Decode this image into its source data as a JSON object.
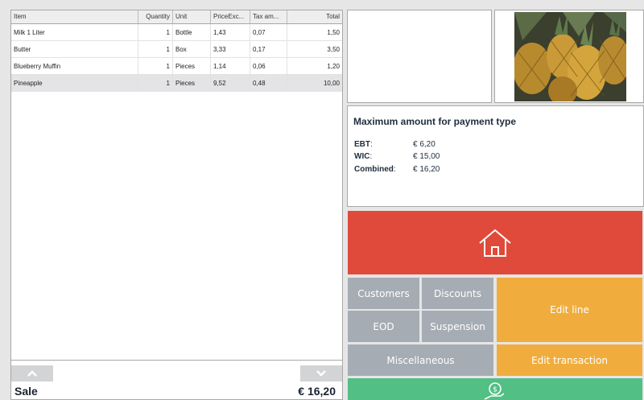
{
  "grid": {
    "columns": [
      "Item",
      "Quantity",
      "Unit",
      "PriceExc...",
      "Tax am...",
      "Total"
    ],
    "rows": [
      {
        "item": "Milk 1 Liter",
        "quantity": "1",
        "unit": "Bottle",
        "price": "1,43",
        "tax": "0,07",
        "total": "1,50"
      },
      {
        "item": "Butter",
        "quantity": "1",
        "unit": "Box",
        "price": "3,33",
        "tax": "0,17",
        "total": "3,50"
      },
      {
        "item": "Blueberry Muffin",
        "quantity": "1",
        "unit": "Pieces",
        "price": "1,14",
        "tax": "0,06",
        "total": "1,20"
      },
      {
        "item": "Pineapple",
        "quantity": "1",
        "unit": "Pieces",
        "price": "9,52",
        "tax": "0,48",
        "total": "10,00"
      }
    ]
  },
  "sale": {
    "label": "Sale",
    "total": "€ 16,20"
  },
  "payment": {
    "title": "Maximum amount for payment type",
    "rows": [
      {
        "label": "EBT",
        "suffix": ":",
        "value": "€ 6,20"
      },
      {
        "label": "WIC",
        "suffix": ":",
        "value": "€ 15,00"
      },
      {
        "label": "Combined",
        "suffix": ":",
        "value": "€ 16,20"
      }
    ]
  },
  "tiles": {
    "customers": "Customers",
    "discounts": "Discounts",
    "eod": "EOD",
    "suspension": "Suspension",
    "miscellaneous": "Miscellaneous",
    "edit_line": "Edit line",
    "edit_transaction": "Edit transaction"
  },
  "icons": {
    "home": "home-icon",
    "payment": "hand-coin-icon",
    "up": "chevron-up-icon",
    "down": "chevron-down-icon"
  },
  "colors": {
    "home_tile": "#e04a3a",
    "gray_tile": "#a6acb3",
    "orange_tile": "#f0ad3d",
    "green_tile": "#52bf84"
  }
}
